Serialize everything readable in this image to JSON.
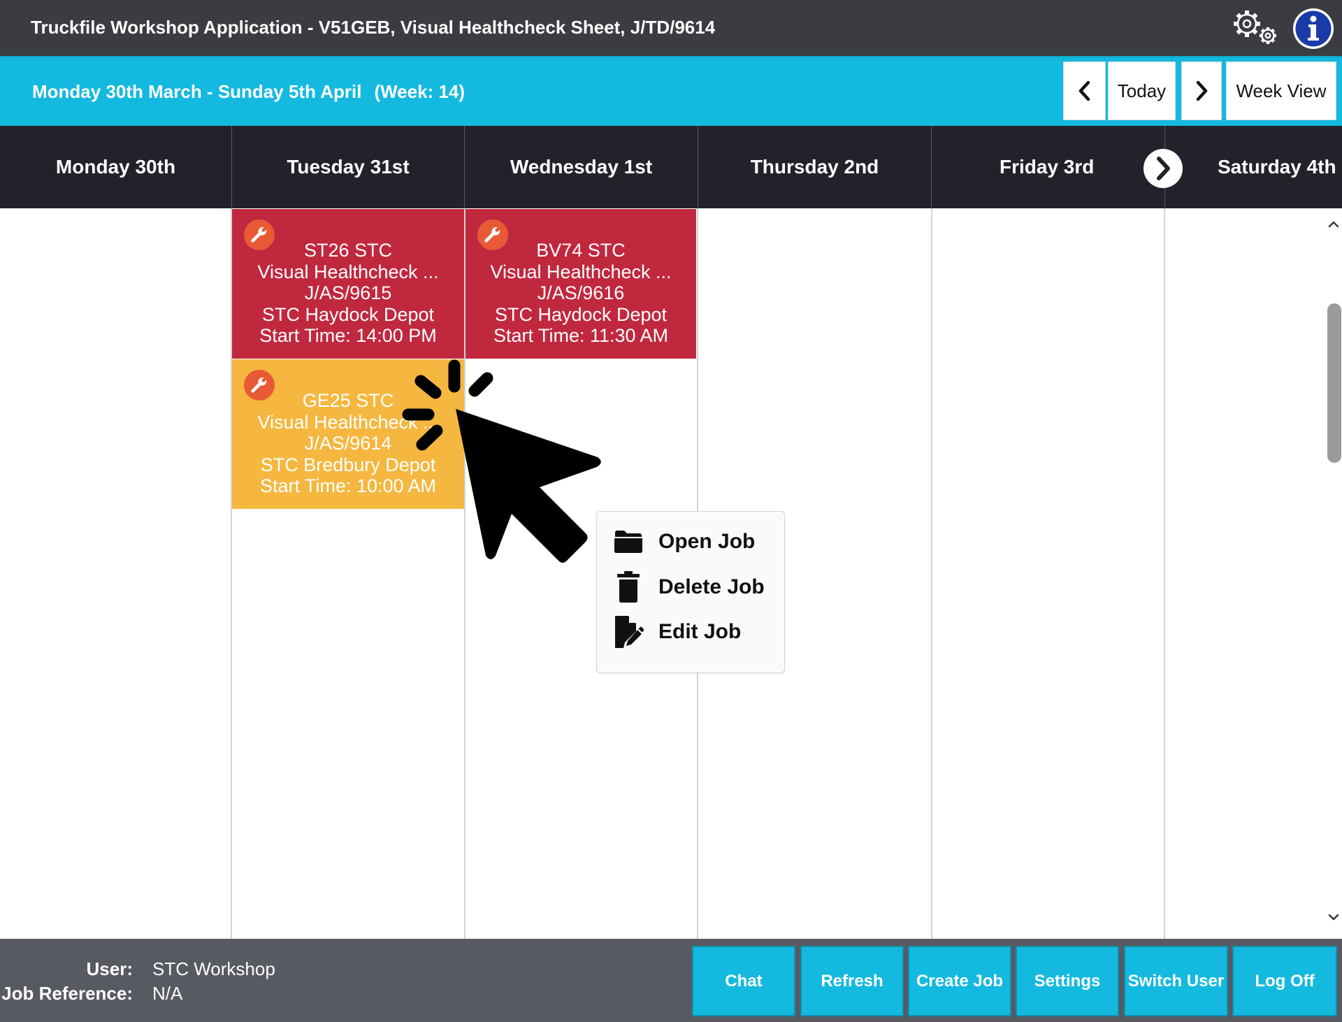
{
  "app": {
    "title": "Truckfile Workshop Application - V51GEB, Visual Healthcheck Sheet, J/TD/9614"
  },
  "toolbar": {
    "date_range": "Monday 30th March - Sunday 5th April",
    "week": "(Week: 14)",
    "today_label": "Today",
    "view_label": "Week View"
  },
  "days": [
    "Monday 30th",
    "Tuesday 31st",
    "Wednesday 1st",
    "Thursday 2nd",
    "Friday 3rd",
    "Saturday 4th"
  ],
  "jobs": [
    {
      "day": "Tuesday 31st",
      "status_color": "#c0283e",
      "vehicle": "ST26 STC",
      "sheet": "Visual Healthcheck ...",
      "reference": "J/AS/9615",
      "depot": "STC Haydock Depot",
      "start": "Start Time: 14:00 PM"
    },
    {
      "day": "Wednesday 1st",
      "status_color": "#c0283e",
      "vehicle": "BV74 STC",
      "sheet": "Visual Healthcheck ...",
      "reference": "J/AS/9616",
      "depot": "STC Haydock Depot",
      "start": "Start Time: 11:30 AM"
    },
    {
      "day": "Tuesday 31st",
      "status_color": "#f5b73f",
      "vehicle": "GE25 STC",
      "sheet": "Visual Healthcheck ...",
      "reference": "J/AS/9614",
      "depot": "STC Bredbury Depot",
      "start": "Start Time: 10:00 AM"
    }
  ],
  "context_menu": {
    "items": [
      {
        "label": "Open Job",
        "icon": "folder-icon"
      },
      {
        "label": "Delete Job",
        "icon": "trash-icon"
      },
      {
        "label": "Edit Job",
        "icon": "file-edit-icon"
      }
    ]
  },
  "footer": {
    "user_label": "User:",
    "user_value": "STC Workshop",
    "job_ref_label": "Job Reference:",
    "job_ref_value": "N/A",
    "buttons": [
      "Chat",
      "Refresh",
      "Create Job",
      "Settings",
      "Switch User",
      "Log Off"
    ]
  },
  "colors": {
    "title_bar": "#3b3c42",
    "accent": "#14b9df",
    "day_header": "#22232a",
    "job_red": "#c0283e",
    "job_yellow": "#f5b73f",
    "wrench_badge": "#e85a35",
    "footer": "#585a62"
  }
}
